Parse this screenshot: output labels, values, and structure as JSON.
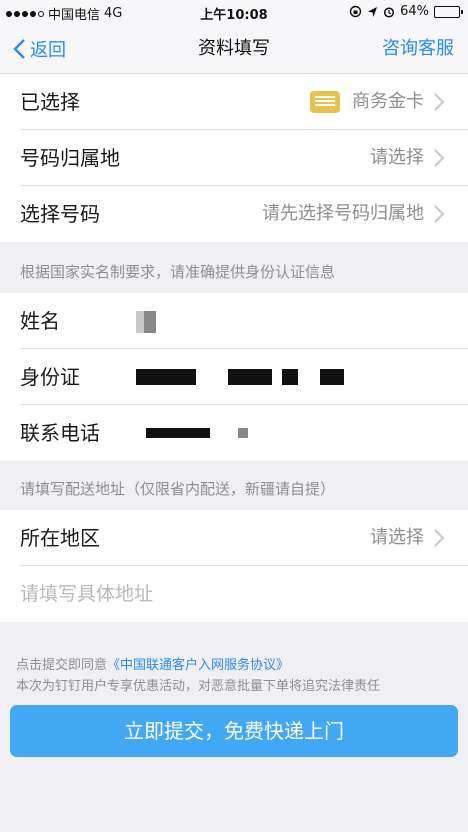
{
  "status": {
    "carrier": "中国电信",
    "network": "4G",
    "time": "上午10:08",
    "battery": "64%",
    "battery_level": 0.64
  },
  "nav": {
    "back_label": "返回",
    "title": "资料填写",
    "right_label": "咨询客服"
  },
  "selection": {
    "selected_label": "已选择",
    "selected_value": "商务金卡",
    "region_label": "号码归属地",
    "region_value": "请选择",
    "number_label": "选择号码",
    "number_value": "请先选择号码归属地"
  },
  "identity_hint": "根据国家实名制要求，请准确提供身份认证信息",
  "identity": {
    "name_label": "姓名",
    "id_label": "身份证",
    "phone_label": "联系电话"
  },
  "address_hint": "请填写配送地址（仅限省内配送，新疆请自提）",
  "address": {
    "area_label": "所在地区",
    "area_value": "请选择",
    "detail_placeholder": "请填写具体地址"
  },
  "agreement": {
    "prefix": "点击提交即同意",
    "link": "《中国联通客户入网服务协议》",
    "notice": "本次为钉钉用户专享优惠活动，对恶意批量下单将追究法律责任"
  },
  "submit_label": "立即提交，免费快递上门",
  "colors": {
    "accent": "#2a8cf0",
    "button": "#40a8f4",
    "card_icon": "#e8c24d"
  }
}
